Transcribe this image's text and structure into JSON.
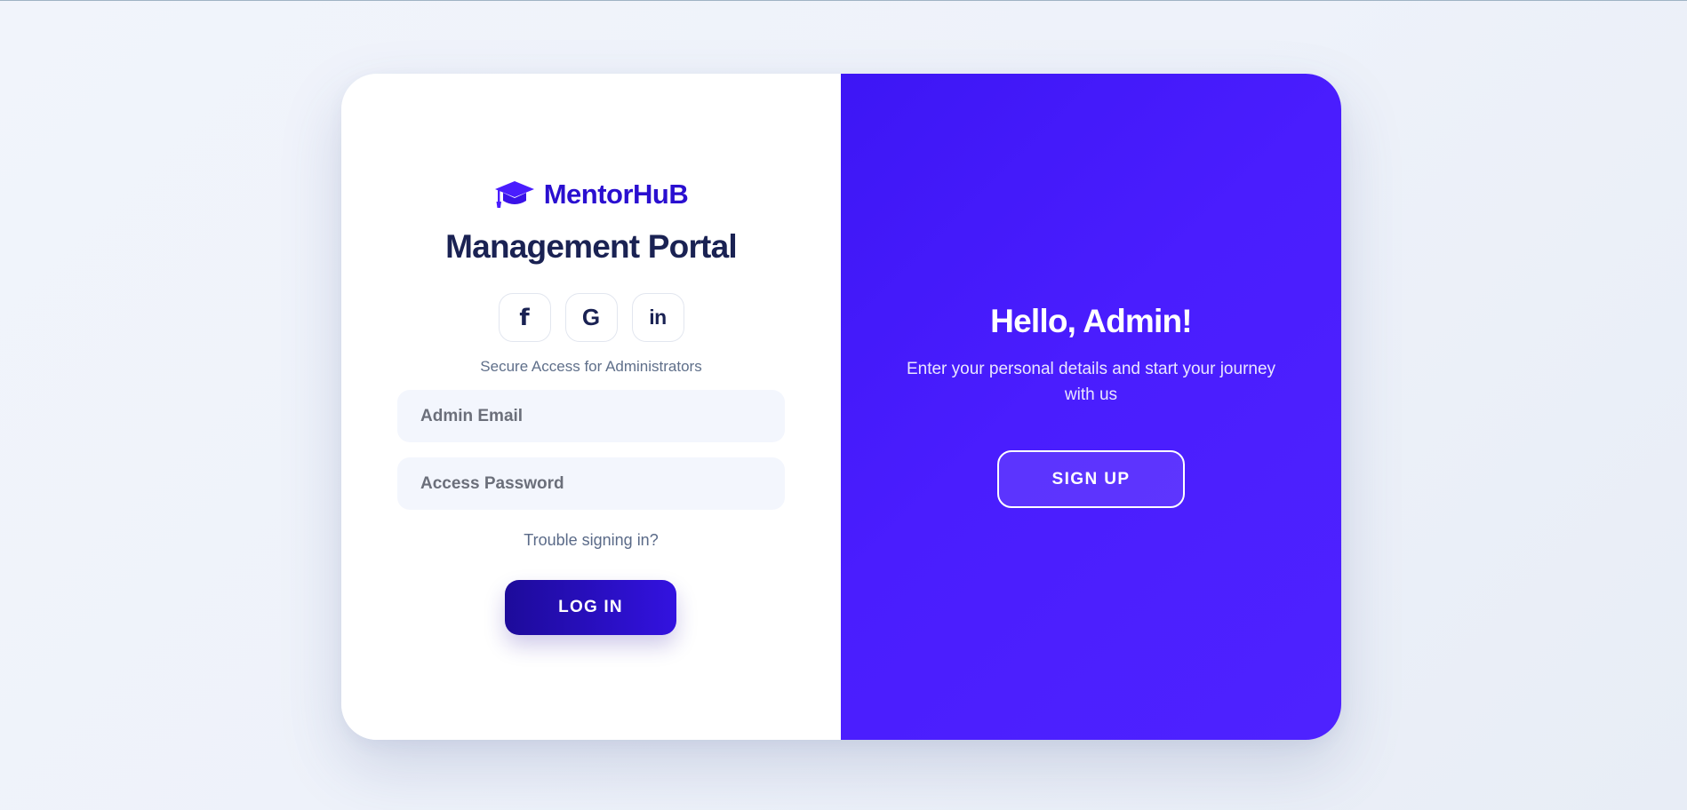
{
  "brand": {
    "name": "MentorHuB",
    "icon": "graduation-cap-icon",
    "color": "#2a0fd0"
  },
  "login": {
    "title": "Management Portal",
    "social_icons": [
      "facebook-icon",
      "google-icon",
      "linkedin-icon"
    ],
    "social_glyphs": {
      "facebook": "f",
      "google": "G",
      "linkedin": "in"
    },
    "subtitle": "Secure Access for Administrators",
    "email_placeholder": "Admin Email",
    "password_placeholder": "Access Password",
    "trouble_link": "Trouble signing in?",
    "submit_label": "LOG IN"
  },
  "welcome": {
    "heading": "Hello, Admin!",
    "text": "Enter your personal details and start your journey with us",
    "signup_label": "SIGN UP"
  },
  "colors": {
    "accent": "#4a1dfe",
    "primary_dark": "#1d0b9a",
    "heading": "#1a2253"
  }
}
